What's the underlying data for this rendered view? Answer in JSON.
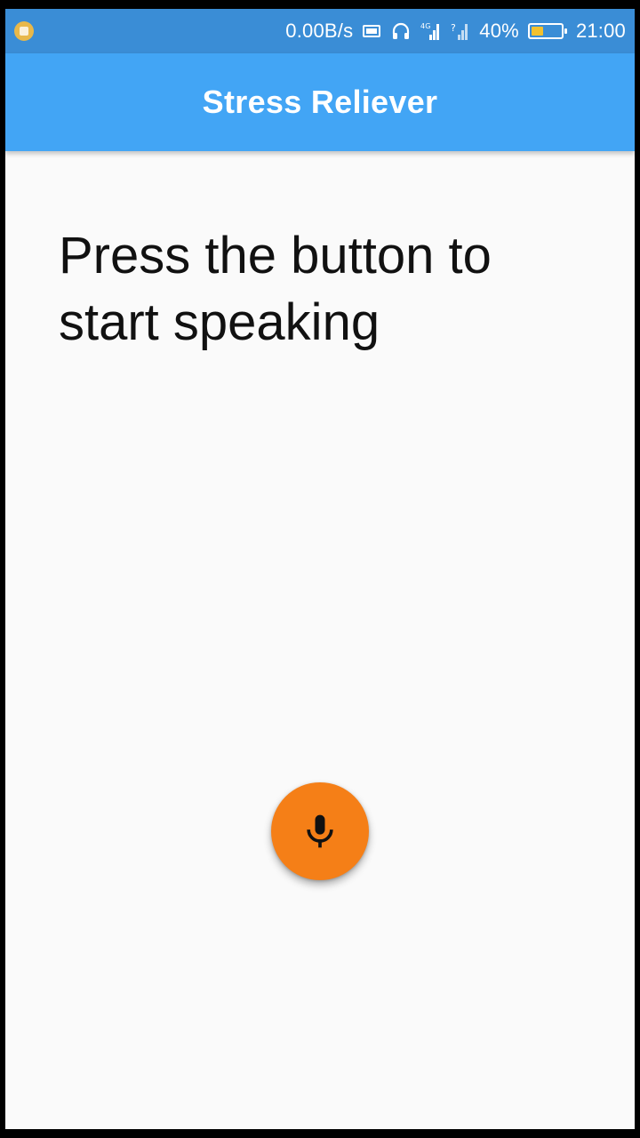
{
  "status_bar": {
    "network_speed": "0.00B/s",
    "signal_1_label": "4G",
    "battery_percent": "40%",
    "battery_level": 0.4,
    "time": "21:00",
    "icons": [
      "notification-icon",
      "cast-icon",
      "headset-icon",
      "signal-4g-icon",
      "signal-no-sim-icon",
      "battery-icon"
    ]
  },
  "app_bar": {
    "title": "Stress Reliever",
    "color": "#42a5f5"
  },
  "main": {
    "prompt": "Press the button to start speaking"
  },
  "fab": {
    "icon": "mic-icon",
    "color": "#f57f17"
  }
}
